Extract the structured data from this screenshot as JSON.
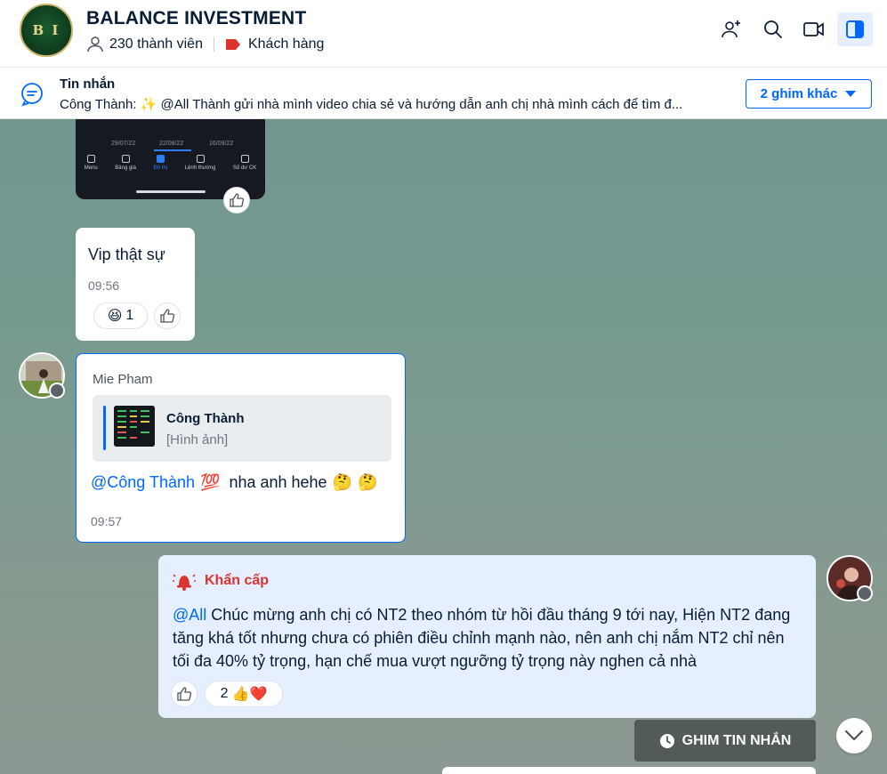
{
  "header": {
    "logo_text": "B I",
    "title": "BALANCE INVESTMENT",
    "members": "230 thành viên",
    "label": "Khách hàng",
    "label_color": "#db342e"
  },
  "pinned": {
    "title": "Tin nhắn",
    "text": "Công Thành: ✨ @All Thành gửi nhà mình video chia sẻ và hướng dẫn anh chị nhà mình cách để tìm đ...",
    "more_label": "2 ghim khác"
  },
  "phone_preview": {
    "dates": [
      "29/07/22",
      "22/08/22",
      "16/09/22"
    ],
    "nav": [
      "Menu",
      "Bảng giá",
      "Đồ thị",
      "Lệnh thường",
      "Số dư CK"
    ],
    "active_nav": "Đồ thị"
  },
  "messages": [
    {
      "text": "Vip thật sự",
      "time": "09:56",
      "reaction_emoji": "😆",
      "reaction_count": "1"
    },
    {
      "sender": "Mie Pham",
      "quote_name": "Công Thành",
      "quote_type": "[Hình ảnh]",
      "mention": "@Công Thành",
      "emoji_1": "💯",
      "text": "nha anh hehe",
      "emoji_2": "🤔",
      "emoji_3": "🤔",
      "time": "09:57"
    },
    {
      "tag": "Khẩn cấp",
      "mention": "@All",
      "text": "Chúc mừng anh chị có NT2 theo nhóm từ hồi đầu tháng 9 tới nay, Hiện NT2 đang tăng khá tốt nhưng chưa có phiên điều chỉnh mạnh nào, nên anh chị nắm NT2 chỉ nên tối đa 40% tỷ trọng, hạn chế mua vượt ngưỡng tỷ trọng này nghen cả nhà",
      "reaction_count": "2",
      "reaction_emojis": "👍❤️"
    }
  ],
  "ghim_button": "GHIM TIN NHẮN",
  "colors": {
    "accent": "#0068ff",
    "urgent": "#db342e",
    "urgent_bg": "#e5efff"
  }
}
